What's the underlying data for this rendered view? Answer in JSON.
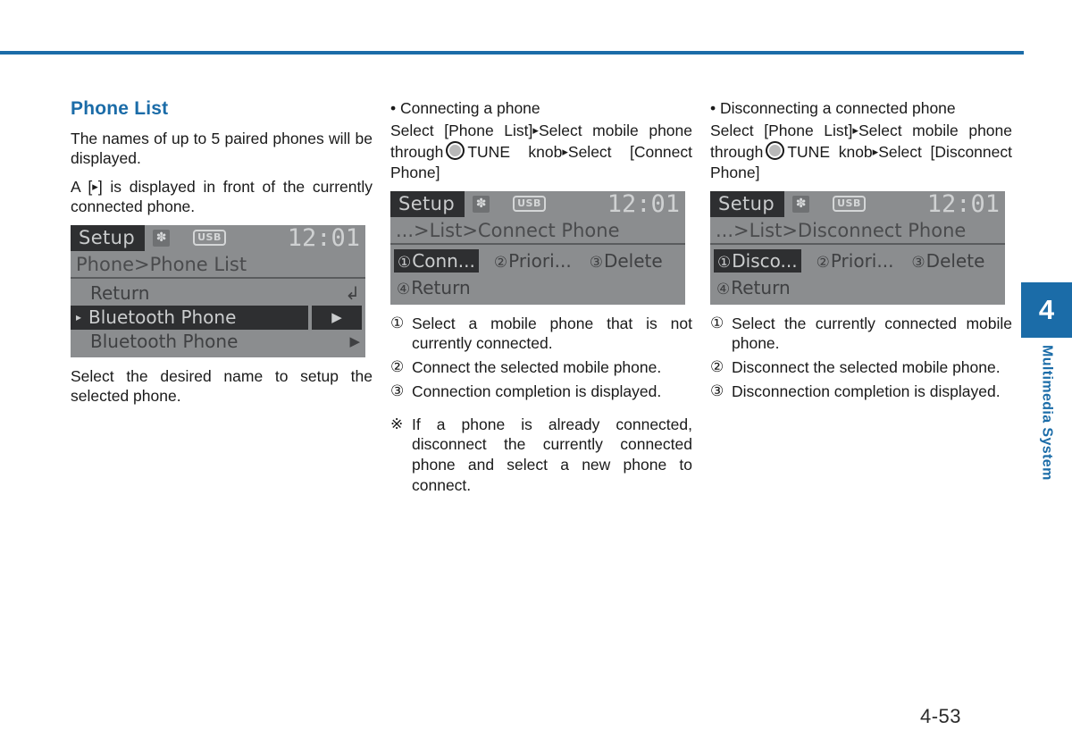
{
  "page": {
    "number": "4-53",
    "chapter_number": "4",
    "chapter_label": "Multimedia System",
    "accent_color": "#1b6ca8"
  },
  "left_column": {
    "title": "Phone List",
    "para1": "The names of up to 5 paired phones will be displayed.",
    "para2_before": "A [",
    "para2_after": "] is displayed in front of the currently connected phone.",
    "para3": "Select the desired name to setup the selected phone.",
    "screen": {
      "title": "Setup",
      "bt_icon": "bluetooth-icon",
      "usb_label": "USB",
      "clock": "12:01",
      "breadcrumb": "Phone>Phone List",
      "rows": [
        {
          "pre": "",
          "text": "Return",
          "end": "return-arrow-icon",
          "selected": false
        },
        {
          "pre": "▸",
          "text": "Bluetooth Phone",
          "end": "▶",
          "selected": true
        },
        {
          "pre": "",
          "text": "Bluetooth Phone",
          "end": "▶",
          "selected": false
        }
      ]
    }
  },
  "middle_column": {
    "bullet": "• Connecting a phone",
    "steps": "Select [Phone List]▸Select mobile phone through ◎ TUNE knob▸Select [Connect Phone]",
    "steps_part1": "Select [Phone List]",
    "steps_part2": "Select mobile phone through",
    "steps_part3": "TUNE knob",
    "steps_part4": "Select [Connect Phone]",
    "screen": {
      "title": "Setup",
      "bt_icon": "bluetooth-icon",
      "usb_label": "USB",
      "clock": "12:01",
      "breadcrumb": "...>List>Connect Phone",
      "tiles_row1": [
        {
          "num": "①",
          "label": "Conn...",
          "highlighted": true
        },
        {
          "num": "②",
          "label": "Priori...",
          "highlighted": false
        },
        {
          "num": "③",
          "label": "Delete",
          "highlighted": false
        }
      ],
      "tiles_row2": [
        {
          "num": "④",
          "label": "Return",
          "highlighted": false
        }
      ]
    },
    "items": [
      {
        "marker": "①",
        "text": "Select a mobile phone that is not currently connected."
      },
      {
        "marker": "②",
        "text": "Connect the selected mobile phone."
      },
      {
        "marker": "③",
        "text": "Connection completion is displayed."
      }
    ],
    "note": {
      "marker": "※",
      "text": "If a phone is already connected, disconnect the currently connected phone and select a new phone to connect."
    }
  },
  "right_column": {
    "bullet": "• Disconnecting a connected phone",
    "steps_part1": "Select [Phone List]",
    "steps_part2": "Select mobile phone through",
    "steps_part3": "TUNE knob",
    "steps_part4": "Select [Disconnect Phone]",
    "screen": {
      "title": "Setup",
      "bt_icon": "bluetooth-icon",
      "usb_label": "USB",
      "clock": "12:01",
      "breadcrumb": "...>List>Disconnect Phone",
      "tiles_row1": [
        {
          "num": "①",
          "label": "Disco...",
          "highlighted": true
        },
        {
          "num": "②",
          "label": "Priori...",
          "highlighted": false
        },
        {
          "num": "③",
          "label": "Delete",
          "highlighted": false
        }
      ],
      "tiles_row2": [
        {
          "num": "④",
          "label": "Return",
          "highlighted": false
        }
      ]
    },
    "items": [
      {
        "marker": "①",
        "text": "Select the currently connected mobile phone."
      },
      {
        "marker": "②",
        "text": "Disconnect the selected mobile phone."
      },
      {
        "marker": "③",
        "text": "Disconnection completion is displayed."
      }
    ]
  }
}
